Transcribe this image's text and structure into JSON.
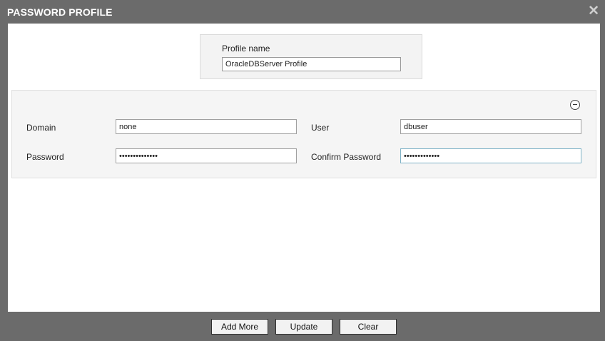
{
  "dialog": {
    "title": "PASSWORD PROFILE",
    "close_icon": "close-icon"
  },
  "profile": {
    "label": "Profile name",
    "value": "OracleDBServer Profile"
  },
  "credentials": {
    "collapse_icon": "minus-circle-icon",
    "domain_label": "Domain",
    "domain_value": "none",
    "user_label": "User",
    "user_value": "dbuser",
    "password_label": "Password",
    "password_value": "••••••••••••••",
    "confirm_password_label": "Confirm Password",
    "confirm_password_value": "•••••••••••••"
  },
  "footer": {
    "add_more_label": "Add More",
    "update_label": "Update",
    "clear_label": "Clear"
  }
}
